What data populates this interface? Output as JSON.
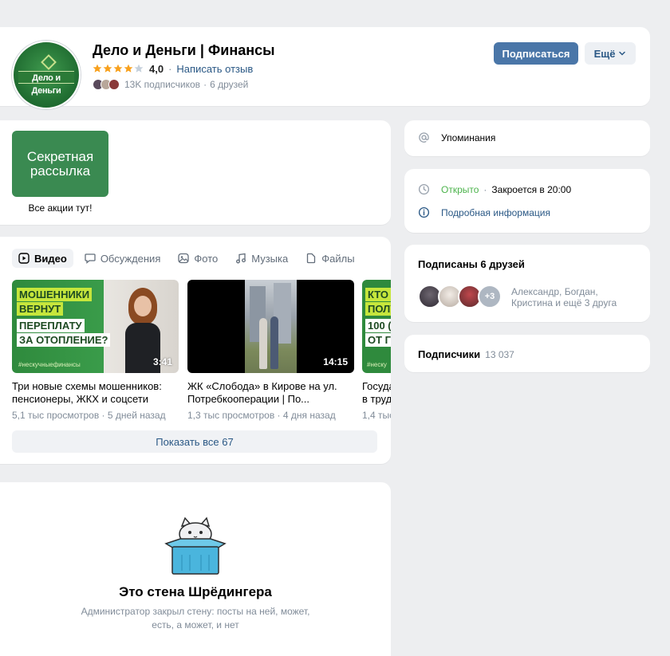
{
  "header": {
    "title": "Дело и Деньги | Финансы",
    "avatar_text": "Дело и Деньги",
    "rating": 4,
    "rating_value": "4,0",
    "review_link": "Написать отзыв",
    "subscribers": "13K подписчиков",
    "friends": "6 друзей",
    "subscribe_label": "Подписаться",
    "more_label": "Ещё"
  },
  "banner": {
    "text": "Секретная рассылка",
    "caption": "Все акции тут!",
    "color": "#3a8a51"
  },
  "media": {
    "tabs": [
      {
        "label": "Видео",
        "icon": "video-icon",
        "active": true
      },
      {
        "label": "Обсуждения",
        "icon": "chat-icon",
        "active": false
      },
      {
        "label": "Фото",
        "icon": "photo-icon",
        "active": false
      },
      {
        "label": "Музыка",
        "icon": "music-icon",
        "active": false
      },
      {
        "label": "Файлы",
        "icon": "file-icon",
        "active": false
      }
    ],
    "videos": [
      {
        "thumb_lines": [
          "МОШЕННИКИ",
          "ВЕРНУТ",
          "ПЕРЕПЛАТУ",
          "ЗА ОТОПЛЕНИЕ?"
        ],
        "thumb_tag": "#нескучныефинансы",
        "duration": "3:41",
        "title": "Три новые схемы мошенников: пенсионеры, ЖКХ и соцсети",
        "views": "5,1 тыс просмотров",
        "age": "5 дней назад"
      },
      {
        "duration": "14:15",
        "title": "ЖК «Слобода» в Кирове на ул. Потребкооперации | По...",
        "views": "1,3 тыс просмотров",
        "age": "4 дня назад"
      },
      {
        "thumb_lines": [
          "КТО",
          "ПОЛУ",
          "100 (",
          "ОТ ГО"
        ],
        "thumb_tag": "#неску",
        "title": "Госуда в труд",
        "views": "1,4 тыс",
        "age": ""
      }
    ],
    "show_all": "Показать все 67"
  },
  "wall": {
    "title": "Это стена Шрёдингера",
    "description": "Администратор закрыл стену: посты на ней, может, есть, а может, и нет"
  },
  "sidebar": {
    "mentions": "Упоминания",
    "status_open": "Открыто",
    "closes": "Закроется в 20:00",
    "more_info": "Подробная информация",
    "friends_title": "Подписаны 6 друзей",
    "friends_extra": "+3",
    "friends_names": "Александр, Богдан, Кристина и ещё 3 друга",
    "subscribers_title": "Подписчики",
    "subscribers_count": "13 037"
  },
  "colors": {
    "accent": "#4a76a8",
    "link": "#2a5885",
    "open": "#4bb34b",
    "star": "#f8a01c"
  }
}
